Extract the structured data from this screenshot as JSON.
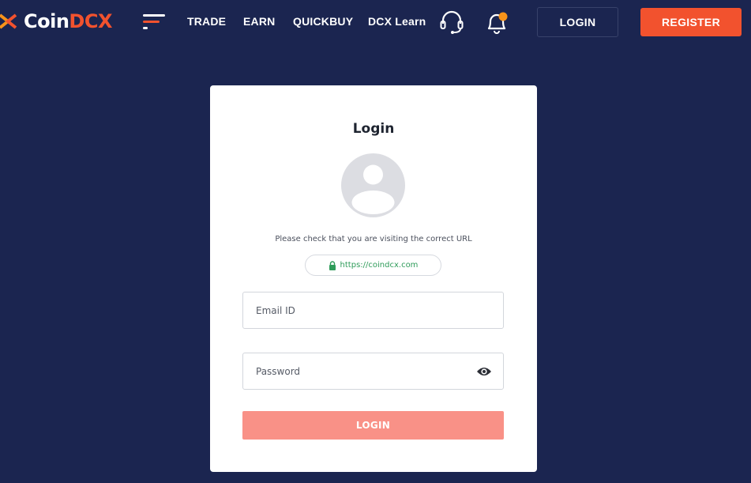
{
  "brand": {
    "name_primary": "Coin",
    "name_accent": "DCX"
  },
  "nav": {
    "items": [
      "TRADE",
      "EARN",
      "QUICKBUY",
      "DCX Learn"
    ],
    "login_label": "LOGIN",
    "register_label": "REGISTER"
  },
  "icons": {
    "menu": "menu-bars-icon",
    "support": "headset-icon",
    "notifications": "bell-icon",
    "avatar": "user-avatar-icon",
    "lock": "lock-icon",
    "password_visibility": "eye-icon"
  },
  "login_card": {
    "title": "Login",
    "url_note": "Please check that you are visiting the correct URL",
    "url": "https://coindcx.com",
    "email_placeholder": "Email ID",
    "email_value": "",
    "password_placeholder": "Password",
    "password_value": "",
    "submit_label": "LOGIN"
  },
  "colors": {
    "background": "#1b2550",
    "accent": "#f2522e",
    "submit_disabled": "#f99187",
    "secure_url": "#2f9c5a",
    "notification_dot": "#f7931a"
  }
}
